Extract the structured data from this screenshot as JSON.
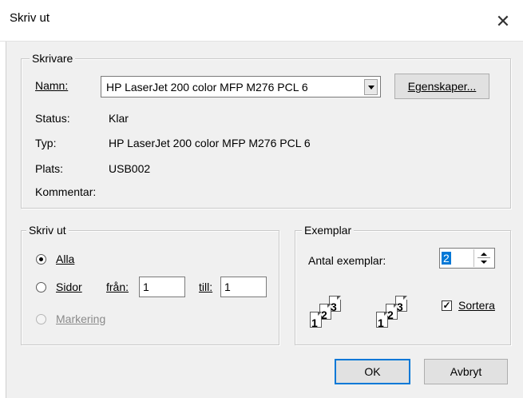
{
  "dialog": {
    "title": "Skriv ut",
    "close_glyph": "✕"
  },
  "printer": {
    "group_label": "Skrivare",
    "name_label": "Namn:",
    "name_value": "HP LaserJet 200 color MFP M276 PCL 6",
    "properties_button": "Egenskaper...",
    "status_label": "Status:",
    "status_value": "Klar",
    "type_label": "Typ:",
    "type_value": "HP LaserJet 200 color MFP M276 PCL 6",
    "location_label": "Plats:",
    "location_value": "USB002",
    "comment_label": "Kommentar:",
    "comment_value": ""
  },
  "print_range": {
    "group_label": "Skriv ut",
    "all_label": "Alla",
    "pages_label": "Sidor",
    "from_label": "från:",
    "from_value": "1",
    "to_label": "till:",
    "to_value": "1",
    "selection_label": "Markering",
    "selected": "all"
  },
  "copies": {
    "group_label": "Exemplar",
    "count_label": "Antal exemplar:",
    "count_value": "2",
    "collate_label": "Sortera",
    "collate_checked": true,
    "collate_pages_set1": [
      "1",
      "2",
      "3"
    ],
    "collate_pages_set2": [
      "1",
      "2",
      "3"
    ]
  },
  "footer": {
    "ok_label": "OK",
    "cancel_label": "Avbryt"
  },
  "colors": {
    "accent": "#0078d7",
    "dialog_bg": "#f0f0f0"
  }
}
